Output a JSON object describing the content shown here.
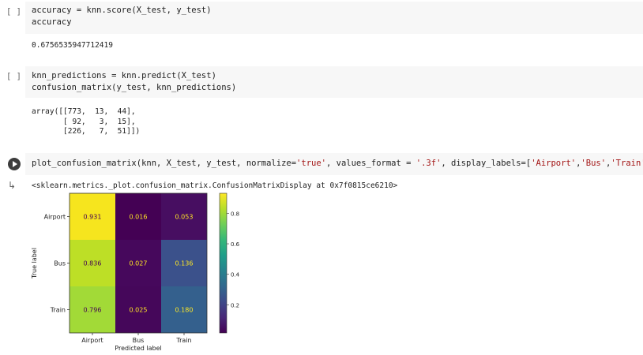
{
  "cells": [
    {
      "gutter": "[ ]",
      "code_lines": [
        "accuracy = knn.score(X_test, y_test)",
        "accuracy"
      ],
      "output_lines": [
        "0.6756535947712419"
      ]
    },
    {
      "gutter": "[ ]",
      "code_lines": [
        "knn_predictions = knn.predict(X_test)",
        "confusion_matrix(y_test, knn_predictions)"
      ],
      "output_lines": [
        "array([[773,  13,  44],",
        "       [ 92,   3,  15],",
        "       [226,   7,  51]])"
      ]
    }
  ],
  "cell3": {
    "code_pre": "plot_confusion_matrix(knn, X_test, y_test, normalize=",
    "code_str1": "'true'",
    "code_mid1": ", values_format = ",
    "code_str2": "'.3f'",
    "code_mid2": ", display_labels=[",
    "code_str3": "'Airport'",
    "code_comma1": ",",
    "code_str4": "'Bus'",
    "code_comma2": ",",
    "code_str5": "'Train'",
    "code_end": "])",
    "output_text": "<sklearn.metrics._plot.confusion_matrix.ConfusionMatrixDisplay at 0x7f0815ce6210>"
  },
  "colors": {
    "code_bg": "#f7f7f7",
    "string": "#a31515"
  },
  "chart_data": {
    "type": "heatmap",
    "row_labels": [
      "Airport",
      "Bus",
      "Train"
    ],
    "col_labels": [
      "Airport",
      "Bus",
      "Train"
    ],
    "values": [
      [
        0.931,
        0.016,
        0.053
      ],
      [
        0.836,
        0.027,
        0.136
      ],
      [
        0.796,
        0.025,
        0.18
      ]
    ],
    "cell_text": [
      [
        "0.931",
        "0.016",
        "0.053"
      ],
      [
        "0.836",
        "0.027",
        "0.136"
      ],
      [
        "0.796",
        "0.025",
        "0.180"
      ]
    ],
    "cell_colors": [
      [
        "#f6e51e",
        "#440154",
        "#470e61"
      ],
      [
        "#bddf26",
        "#46085c",
        "#3b518b"
      ],
      [
        "#a2da37",
        "#45075a",
        "#34608d"
      ]
    ],
    "xlabel": "Predicted label",
    "ylabel": "True label",
    "colorbar_ticks": [
      0.8,
      0.6,
      0.4,
      0.2
    ],
    "colorbar_tick_labels": [
      "0.8",
      "0.6",
      "0.4",
      "0.2"
    ],
    "colorbar_range": [
      0.016,
      0.931
    ],
    "colormap": [
      "#440154",
      "#482878",
      "#3e4a89",
      "#31688e",
      "#26828e",
      "#1f9e89",
      "#35b779",
      "#6ece58",
      "#b5de2b",
      "#fde725"
    ]
  }
}
